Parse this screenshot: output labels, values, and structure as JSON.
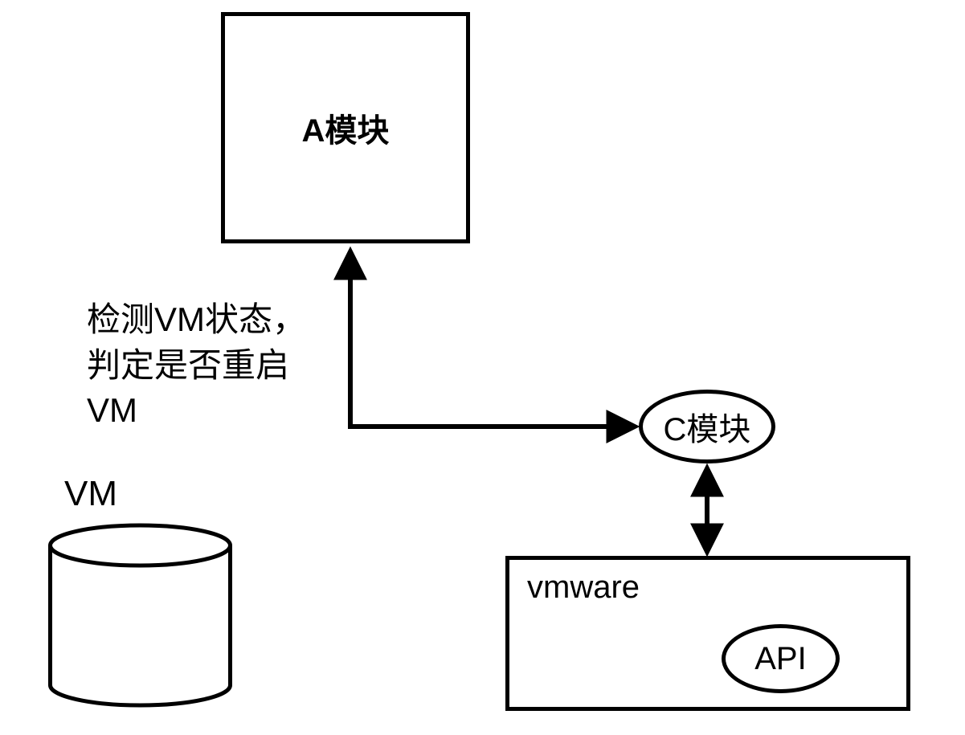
{
  "moduleA": {
    "label": "A模块"
  },
  "annotation": {
    "line1": "检测VM状态，",
    "line2": "判定是否重启",
    "line3": "VM"
  },
  "vm": {
    "label": "VM"
  },
  "moduleC": {
    "label": "C模块"
  },
  "vmware": {
    "label": "vmware",
    "api": "API"
  }
}
